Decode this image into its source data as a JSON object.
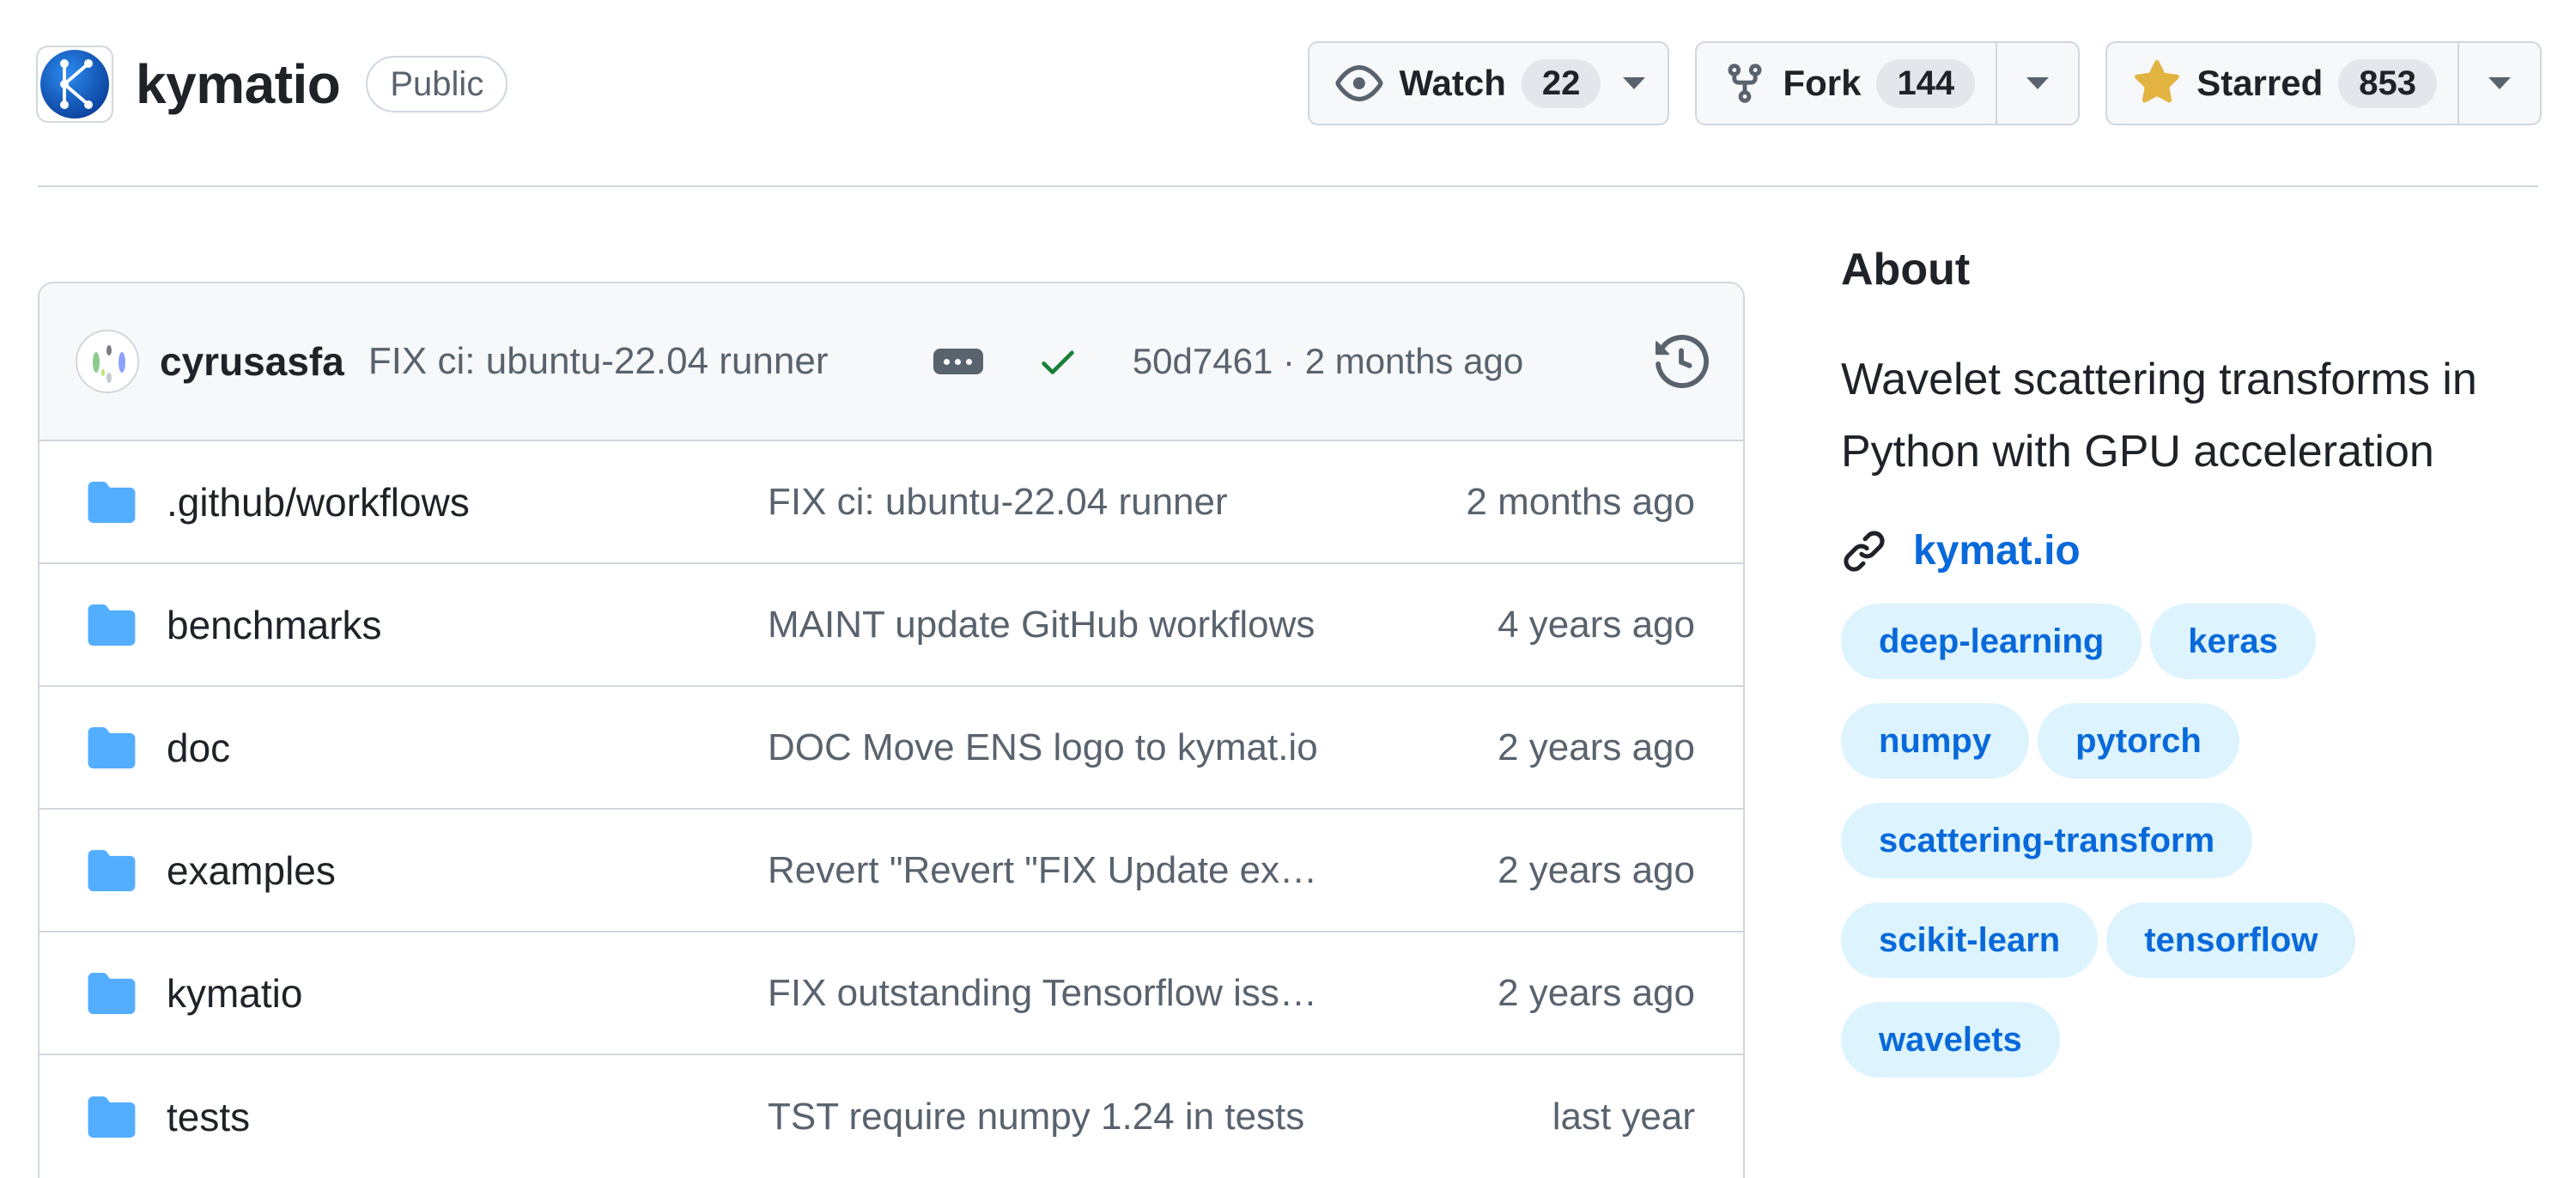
{
  "repo": {
    "name": "kymatio",
    "visibility": "Public",
    "avatar_icon": "kymatio-logo-icon",
    "avatar_letter": "K",
    "brand_color": "#1565c0"
  },
  "actions": {
    "watch": {
      "label": "Watch",
      "count": "22",
      "icon": "eye-icon"
    },
    "fork": {
      "label": "Fork",
      "count": "144",
      "icon": "repo-forked-icon"
    },
    "star": {
      "label": "Starred",
      "count": "853",
      "icon": "star-filled-icon",
      "icon_color": "#e3b341"
    }
  },
  "latest_commit": {
    "author": "cyrusasfa",
    "message": "FIX ci: ubuntu-22.04 runner",
    "status": "success",
    "status_color": "#1a7f37",
    "sha": "50d7461",
    "separator": "·",
    "time": "2 months ago"
  },
  "files": [
    {
      "name": ".github/workflows",
      "message": "FIX ci: ubuntu-22.04 runner",
      "time": "2 months ago"
    },
    {
      "name": "benchmarks",
      "message": "MAINT update GitHub workflows",
      "time": "4 years ago"
    },
    {
      "name": "doc",
      "message": "DOC Move ENS logo to kymat.io",
      "time": "2 years ago"
    },
    {
      "name": "examples",
      "message": "Revert \"Revert \"FIX Update examples\"\"",
      "time": "2 years ago"
    },
    {
      "name": "kymatio",
      "message": "FIX outstanding Tensorflow issues",
      "time": "2 years ago"
    },
    {
      "name": "tests",
      "message": "TST require numpy 1.24 in tests",
      "time": "last year"
    }
  ],
  "about": {
    "heading": "About",
    "description": "Wavelet scattering transforms in Python with GPU acceleration",
    "website": "kymat.io",
    "topics": [
      "deep-learning",
      "keras",
      "numpy",
      "pytorch",
      "scattering-transform",
      "scikit-learn",
      "tensorflow",
      "wavelets"
    ]
  },
  "colors": {
    "folder": "#54aeff",
    "link": "#0969da",
    "topic_bg": "#ddf4ff",
    "border": "#d0d7de"
  }
}
